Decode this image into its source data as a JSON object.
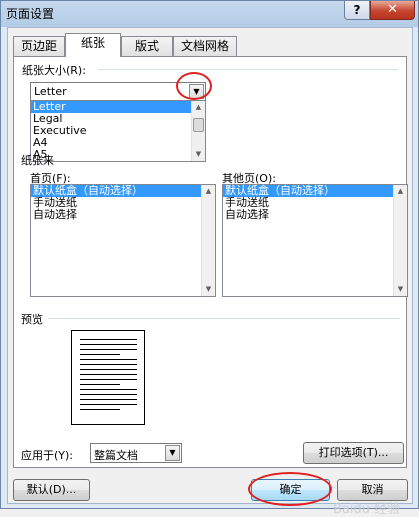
{
  "window": {
    "title": "页面设置",
    "help_label": "?",
    "close_label": "✕"
  },
  "tabs": [
    {
      "label": "页边距",
      "active": false
    },
    {
      "label": "纸张",
      "active": true
    },
    {
      "label": "版式",
      "active": false
    },
    {
      "label": "文档网格",
      "active": false
    }
  ],
  "paper_size": {
    "label": "纸张大小(R):",
    "selected": "Letter",
    "options": [
      "Letter",
      "Legal",
      "Executive",
      "A4",
      "A5"
    ],
    "highlighted_index": 0
  },
  "paper_source": {
    "label_visible": "纸张来",
    "first_page": {
      "label": "首页(F):",
      "items": [
        "默认纸盒（自动选择）",
        "手动送纸",
        "自动选择"
      ],
      "selected_index": 0
    },
    "other_pages": {
      "label": "其他页(O):",
      "items": [
        "默认纸盒（自动选择）",
        "手动送纸",
        "自动选择"
      ],
      "selected_index": 0
    }
  },
  "preview": {
    "label": "预览"
  },
  "apply_to": {
    "label": "应用于(Y):",
    "value": "整篇文档"
  },
  "print_options_label": "打印选项(T)...",
  "buttons": {
    "default_label": "默认(D)...",
    "ok_label": "确定",
    "cancel_label": "取消"
  },
  "watermark": "Baidu 经验",
  "colors": {
    "selection": "#3399ff",
    "annotation_ring": "#e02020"
  },
  "icons": {
    "dropdown": "triangle-down",
    "scroll_up": "triangle-up",
    "scroll_down": "triangle-down"
  }
}
